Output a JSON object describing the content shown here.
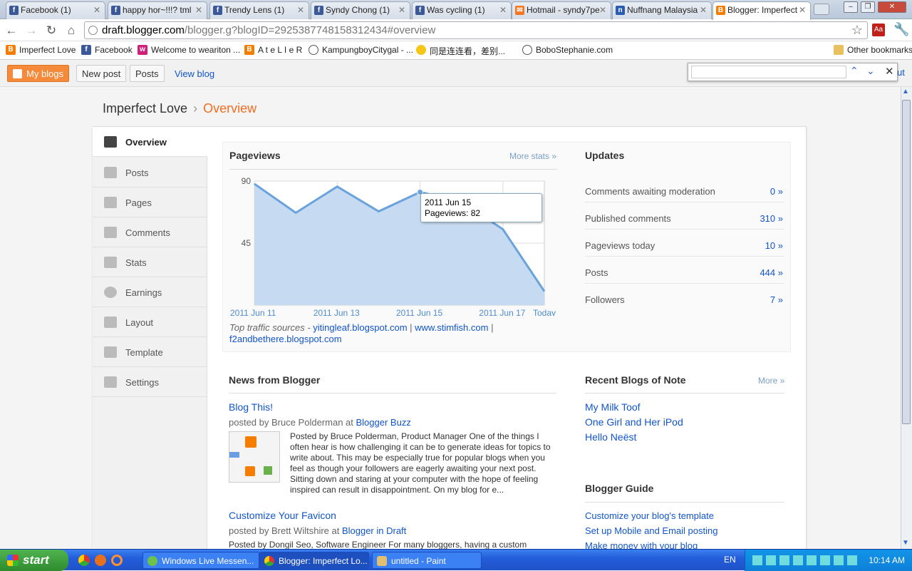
{
  "tabs": [
    {
      "title": "Facebook (1)",
      "icon": "facebook-icon"
    },
    {
      "title": "happy hor~!!!? tml",
      "icon": "facebook-icon"
    },
    {
      "title": "Trendy Lens (1)",
      "icon": "facebook-icon"
    },
    {
      "title": "Syndy Chong (1)",
      "icon": "facebook-icon"
    },
    {
      "title": "Was cycling (1)",
      "icon": "facebook-icon"
    },
    {
      "title": "Hotmail - syndy7pe",
      "icon": "hotmail-icon"
    },
    {
      "title": "Nuffnang Malaysia",
      "icon": "nuffnang-icon"
    },
    {
      "title": "Blogger: Imperfect",
      "icon": "blogger-icon"
    }
  ],
  "address": {
    "host": "draft.blogger.com",
    "path": "/blogger.g?blogID=2925387748158312434#overview"
  },
  "bookmarks": [
    {
      "label": "Imperfect Love",
      "icon": "blogger-icon"
    },
    {
      "label": "Facebook",
      "icon": "facebook-icon"
    },
    {
      "label": "Welcome to weariton ...",
      "icon": "weariton-icon"
    },
    {
      "label": "A t e L I e R",
      "icon": "blogger-icon"
    },
    {
      "label": "KampungboyCitygal - ...",
      "icon": "globe-icon"
    },
    {
      "label": "同是连连看，差别...",
      "icon": "smiley-icon"
    },
    {
      "label": "BoboStephanie.com",
      "icon": "globe-icon"
    }
  ],
  "other_bookmarks": "Other bookmarks",
  "bar": {
    "my_blogs": "My blogs",
    "new_post": "New post",
    "posts": "Posts",
    "view_blog": "View blog",
    "find_value": "",
    "cut_text": "ut"
  },
  "breadcrumb": {
    "blog": "Imperfect Love",
    "sep": "›",
    "current": "Overview"
  },
  "nav": [
    "Overview",
    "Posts",
    "Pages",
    "Comments",
    "Stats",
    "Earnings",
    "Layout",
    "Template",
    "Settings"
  ],
  "pageviews": {
    "title": "Pageviews",
    "more": "More stats »",
    "tooltip_date": "2011 Jun 15",
    "tooltip_value": "Pageviews: 82",
    "traffic_label": "Top traffic sources - ",
    "sources": [
      "yitingleaf.blogspot.com",
      "www.stimfish.com",
      "f2andbethere.blogspot.com"
    ]
  },
  "chart_data": {
    "type": "area",
    "x": [
      "2011 Jun 11",
      "2011 Jun 12",
      "2011 Jun 13",
      "2011 Jun 14",
      "2011 Jun 15",
      "2011 Jun 16",
      "2011 Jun 17",
      "Today"
    ],
    "series": [
      {
        "values": [
          88,
          67,
          86,
          68,
          82,
          75,
          55,
          10
        ]
      }
    ],
    "x_tick_labels": [
      "2011 Jun 11",
      "2011 Jun 13",
      "2011 Jun 15",
      "2011 Jun 17",
      "Today"
    ],
    "y_ticks": [
      90,
      45
    ],
    "ylim": [
      0,
      90
    ],
    "color": "#6aa3dc",
    "fill": "#c6dbf2"
  },
  "updates": {
    "title": "Updates",
    "rows": [
      {
        "label": "Comments awaiting moderation",
        "value": "0 »"
      },
      {
        "label": "Published comments",
        "value": "310 »"
      },
      {
        "label": "Pageviews today",
        "value": "10 »"
      },
      {
        "label": "Posts",
        "value": "444 »"
      },
      {
        "label": "Followers",
        "value": "7 »"
      }
    ]
  },
  "news": {
    "title": "News from Blogger",
    "items": [
      {
        "title": "Blog This!",
        "by": "posted by Bruce Polderman at ",
        "source": "Blogger Buzz",
        "body": "Posted by Bruce Polderman, Product Manager One of the things I often hear is how challenging it can be to generate ideas for topics to write about. This may be especially true for popular blogs when you feel as though your followers are eagerly awaiting your next post. Sitting down and staring at your computer with the hope of feeling inspired can result in disappointment.  On my blog for e..."
      },
      {
        "title": "Customize Your Favicon",
        "by": "posted by Brett Wiltshire at ",
        "source": "Blogger in Draft",
        "body": "Posted by Dongil Seo, Software Engineer For many bloggers, having a custom"
      }
    ]
  },
  "notes": {
    "title": "Recent Blogs of Note",
    "more": "More »",
    "items": [
      "My Milk Toof",
      "One Girl and Her iPod",
      "Hello Neëst"
    ]
  },
  "guide": {
    "title": "Blogger Guide",
    "items": [
      "Customize your blog's template",
      "Set up Mobile and Email posting",
      "Make money with your blog"
    ]
  },
  "taskbar": {
    "start": "start",
    "tasks": [
      "Windows Live Messen...",
      "Blogger: Imperfect Lo...",
      "untitled - Paint"
    ],
    "lang": "EN",
    "clock": "10:14 AM"
  }
}
